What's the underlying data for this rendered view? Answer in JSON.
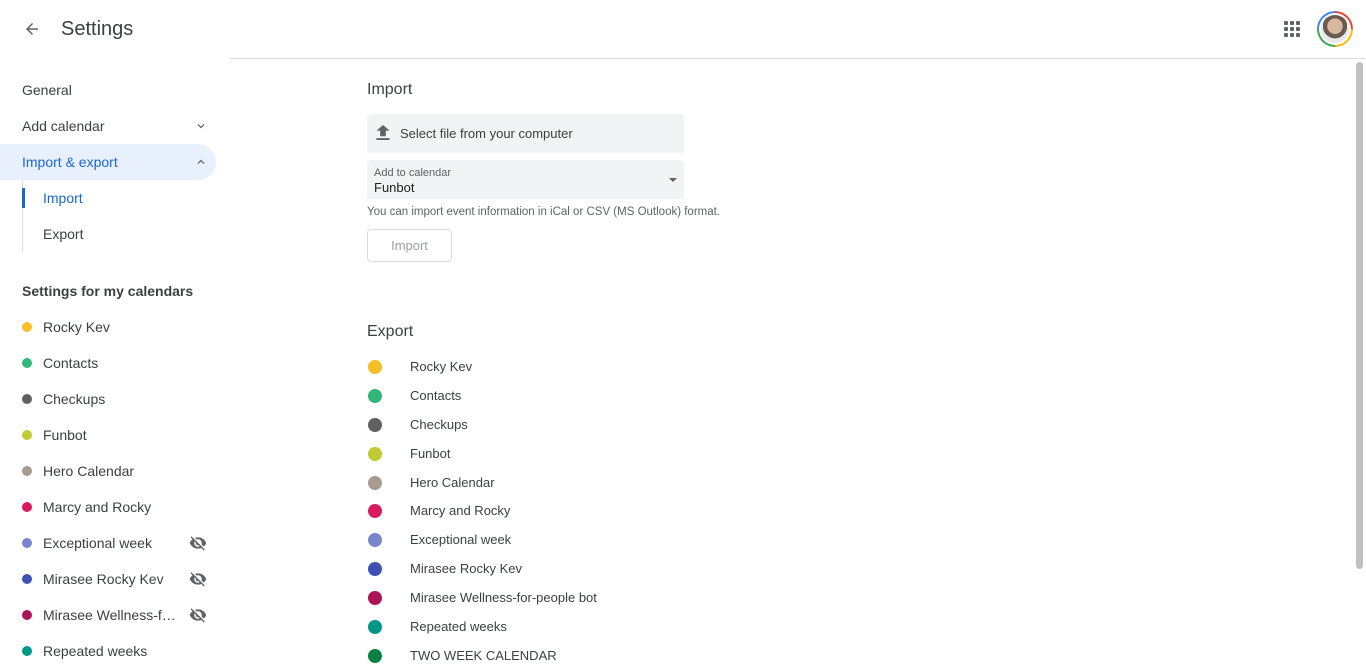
{
  "header": {
    "title": "Settings"
  },
  "sidebar": {
    "nav": [
      {
        "label": "General"
      },
      {
        "label": "Add calendar"
      },
      {
        "label": "Import & export"
      }
    ],
    "sub": [
      {
        "label": "Import"
      },
      {
        "label": "Export"
      }
    ],
    "section_title": "Settings for my calendars",
    "calendars": [
      {
        "name": "Rocky Kev",
        "color": "#f6bf26",
        "hidden": false
      },
      {
        "name": "Contacts",
        "color": "#33b679",
        "hidden": false
      },
      {
        "name": "Checkups",
        "color": "#616161",
        "hidden": false
      },
      {
        "name": "Funbot",
        "color": "#c0ca33",
        "hidden": false
      },
      {
        "name": "Hero Calendar",
        "color": "#a79b8e",
        "hidden": false
      },
      {
        "name": "Marcy and Rocky",
        "color": "#d81b60",
        "hidden": false
      },
      {
        "name": "Exceptional week",
        "color": "#7986cb",
        "hidden": true
      },
      {
        "name": "Mirasee Rocky Kev",
        "color": "#3f51b5",
        "hidden": true
      },
      {
        "name": "Mirasee Wellness-for-people bot",
        "color": "#ad1457",
        "hidden": true
      },
      {
        "name": "Repeated weeks",
        "color": "#009688",
        "hidden": false
      }
    ]
  },
  "import": {
    "heading": "Import",
    "file_button": "Select file from your computer",
    "select_label": "Add to calendar",
    "select_value": "Funbot",
    "help": "You can import event information in iCal or CSV (MS Outlook) format.",
    "button": "Import"
  },
  "export": {
    "heading": "Export",
    "calendars": [
      {
        "name": "Rocky Kev",
        "color": "#f6bf26"
      },
      {
        "name": "Contacts",
        "color": "#33b679"
      },
      {
        "name": "Checkups",
        "color": "#616161"
      },
      {
        "name": "Funbot",
        "color": "#c0ca33"
      },
      {
        "name": "Hero Calendar",
        "color": "#a79b8e"
      },
      {
        "name": "Marcy and Rocky",
        "color": "#d81b60"
      },
      {
        "name": "Exceptional week",
        "color": "#7986cb"
      },
      {
        "name": "Mirasee Rocky Kev",
        "color": "#3f51b5"
      },
      {
        "name": "Mirasee Wellness-for-people bot",
        "color": "#ad1457"
      },
      {
        "name": "Repeated weeks",
        "color": "#009688"
      },
      {
        "name": "TWO WEEK CALENDAR",
        "color": "#0b8043"
      }
    ]
  },
  "colors": {
    "accent": "#1967d2",
    "active_bg": "#e8f0fe"
  },
  "icons": {
    "back": "arrow-back-icon",
    "apps": "apps-grid-icon",
    "upload": "upload-icon",
    "hidden": "visibility-off-icon",
    "chevron_down": "chevron-down-icon",
    "chevron_up": "chevron-up-icon"
  }
}
